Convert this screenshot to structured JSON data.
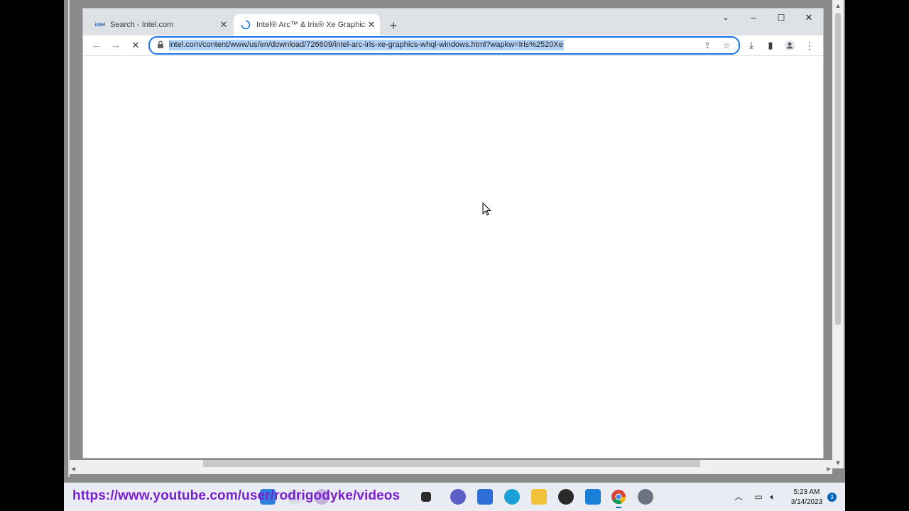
{
  "browser": {
    "tabs": [
      {
        "favicon": "intel",
        "title": "Search - Intel.com",
        "state": "inactive"
      },
      {
        "favicon": "loading-spinner",
        "title": "Intel® Arc™ & Iris® Xe Graphics",
        "state": "active-loading"
      }
    ],
    "new_tab_symbol": "+",
    "window_controls": {
      "tab_search": "⌄",
      "minimize": "–",
      "maximize": "☐",
      "close": "✕"
    },
    "address_bar": {
      "url": "intel.com/content/www/us/en/download/726609/intel-arc-iris-xe-graphics-whql-windows.html?wapkw=Iris%2520Xe",
      "selected": true
    },
    "nav": {
      "back": "←",
      "forward": "→",
      "stop": "✕"
    }
  },
  "taskbar": {
    "overlay_text": "https://www.youtube.com/user/rodrigodyke/videos",
    "apps": [
      "start-icon",
      "search-icon",
      "task-view-icon",
      "teams-chat-icon",
      "store-icon",
      "edge-icon",
      "file-explorer-icon",
      "media-player-icon",
      "feedback-hub-icon",
      "chrome-icon",
      "settings-icon"
    ],
    "clock": {
      "time": "5:23 AM",
      "date": "3/14/2023"
    },
    "notification_count": "3"
  },
  "colors": {
    "accent": "#1a73e8",
    "url_selection": "#b3d2f7",
    "tabstrip": "#dee1e6",
    "overlay_text": "#7a1fd1"
  }
}
